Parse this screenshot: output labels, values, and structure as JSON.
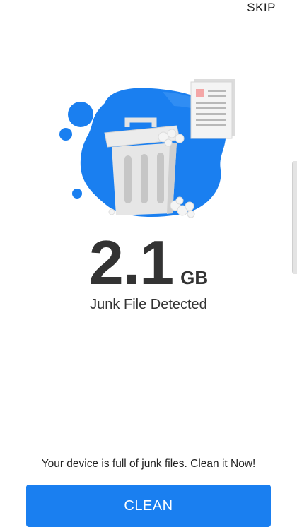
{
  "header": {
    "skip_label": "SKIP"
  },
  "illustration": {
    "icon": "trash-bin-with-document-icon",
    "colors": {
      "blob": "#1a7ff0",
      "bin": "#e0e0e0",
      "document": "#f2f2f2",
      "document_accent": "#f4a6a6"
    }
  },
  "result": {
    "size_value": "2.1",
    "size_unit": "GB",
    "label": "Junk File Detected"
  },
  "footer": {
    "message": "Your device is full of junk files. Clean it Now!",
    "clean_label": "CLEAN"
  },
  "colors": {
    "accent": "#1a7ff0",
    "text": "#333333"
  }
}
